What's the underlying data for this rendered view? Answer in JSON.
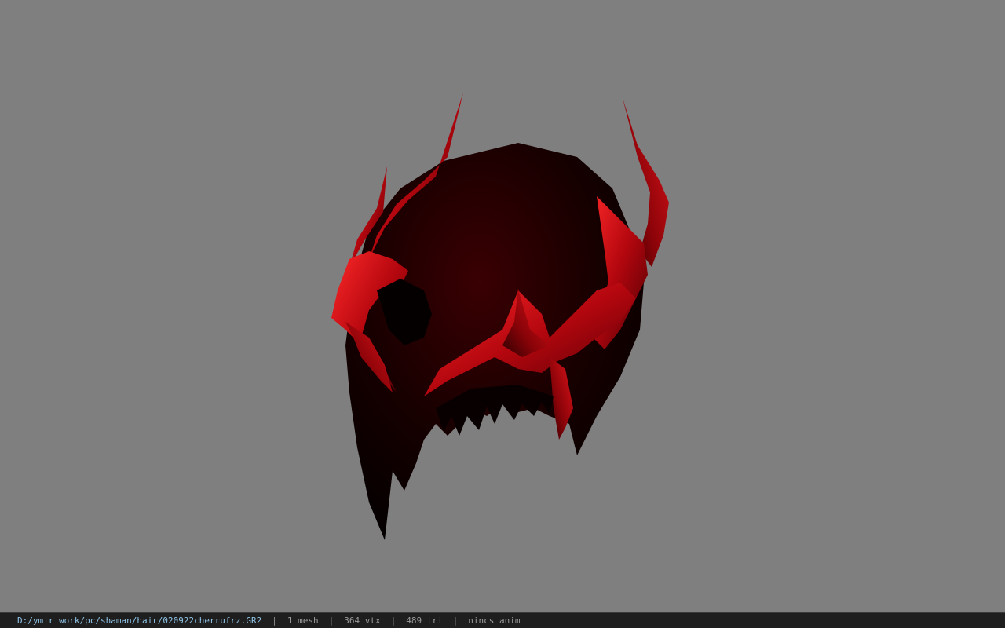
{
  "viewer": {
    "background_color": "#7f7f7f",
    "model": {
      "icon": "red-horned-helmet-model",
      "primary_color": "#c0101a",
      "shadow_color": "#120000"
    }
  },
  "status_bar": {
    "file_path": "D:/ymir work/pc/shaman/hair/020922cherrufrz.GR2",
    "separator": "|",
    "mesh_count": "1 mesh",
    "vertex_count": "364 vtx",
    "triangle_count": "489 tri",
    "anim_status": "nincs anim"
  }
}
